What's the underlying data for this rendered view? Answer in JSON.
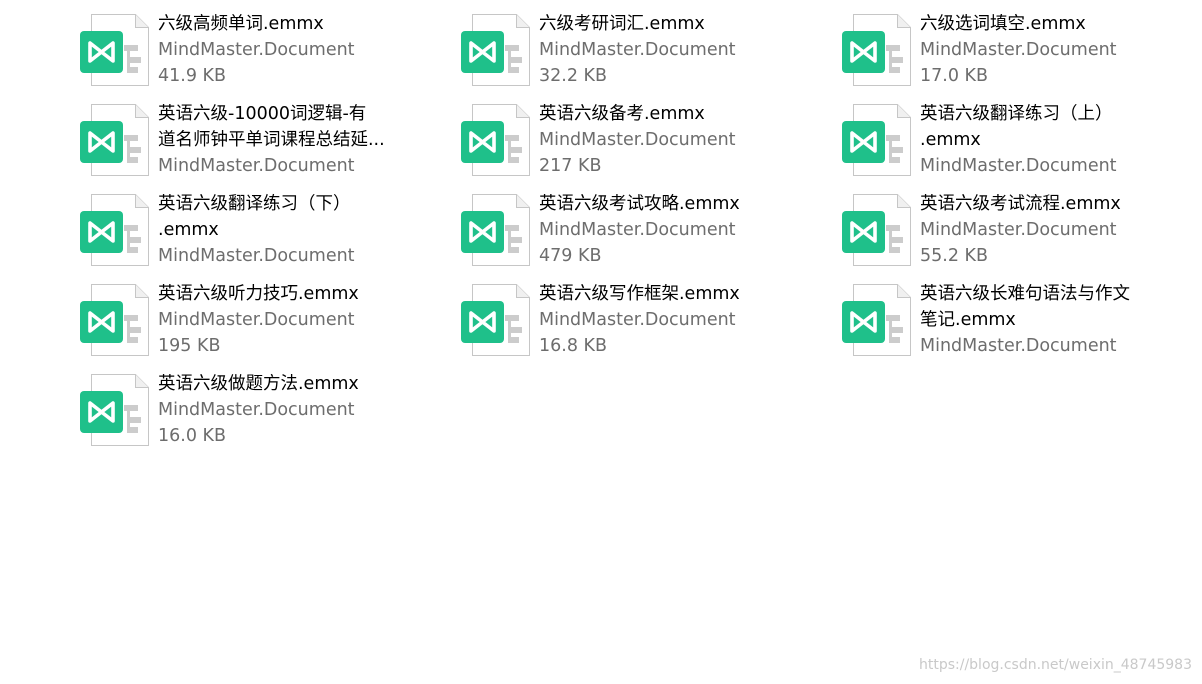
{
  "icon": "mindmaster-document-icon",
  "colors": {
    "background": "#ffffff",
    "filename": "#000000",
    "details": "#6d6d6d",
    "icon_green": "#1fc08a",
    "watermark": "#c9c9c9"
  },
  "files": [
    {
      "name_lines": [
        "六级高频单词.emmx"
      ],
      "type": "MindMaster.Document",
      "size": "41.9 KB"
    },
    {
      "name_lines": [
        "六级考研词汇.emmx"
      ],
      "type": "MindMaster.Document",
      "size": "32.2 KB"
    },
    {
      "name_lines": [
        "六级选词填空.emmx"
      ],
      "type": "MindMaster.Document",
      "size": "17.0 KB"
    },
    {
      "name_lines": [
        "英语六级-10000词逻辑-有",
        "道名师钟平单词课程总结延..."
      ],
      "type": "MindMaster.Document"
    },
    {
      "name_lines": [
        "英语六级备考.emmx"
      ],
      "type": "MindMaster.Document",
      "size": "217 KB"
    },
    {
      "name_lines": [
        "英语六级翻译练习（上）",
        ".emmx"
      ],
      "type": "MindMaster.Document"
    },
    {
      "name_lines": [
        "英语六级翻译练习（下）",
        ".emmx"
      ],
      "type": "MindMaster.Document"
    },
    {
      "name_lines": [
        "英语六级考试攻略.emmx"
      ],
      "type": "MindMaster.Document",
      "size": "479 KB"
    },
    {
      "name_lines": [
        "英语六级考试流程.emmx"
      ],
      "type": "MindMaster.Document",
      "size": "55.2 KB"
    },
    {
      "name_lines": [
        "英语六级听力技巧.emmx"
      ],
      "type": "MindMaster.Document",
      "size": "195 KB"
    },
    {
      "name_lines": [
        "英语六级写作框架.emmx"
      ],
      "type": "MindMaster.Document",
      "size": "16.8 KB"
    },
    {
      "name_lines": [
        "英语六级长难句语法与作文",
        "笔记.emmx"
      ],
      "type": "MindMaster.Document"
    },
    {
      "name_lines": [
        "英语六级做题方法.emmx"
      ],
      "type": "MindMaster.Document",
      "size": "16.0 KB"
    }
  ],
  "watermark": "https://blog.csdn.net/weixin_48745983"
}
